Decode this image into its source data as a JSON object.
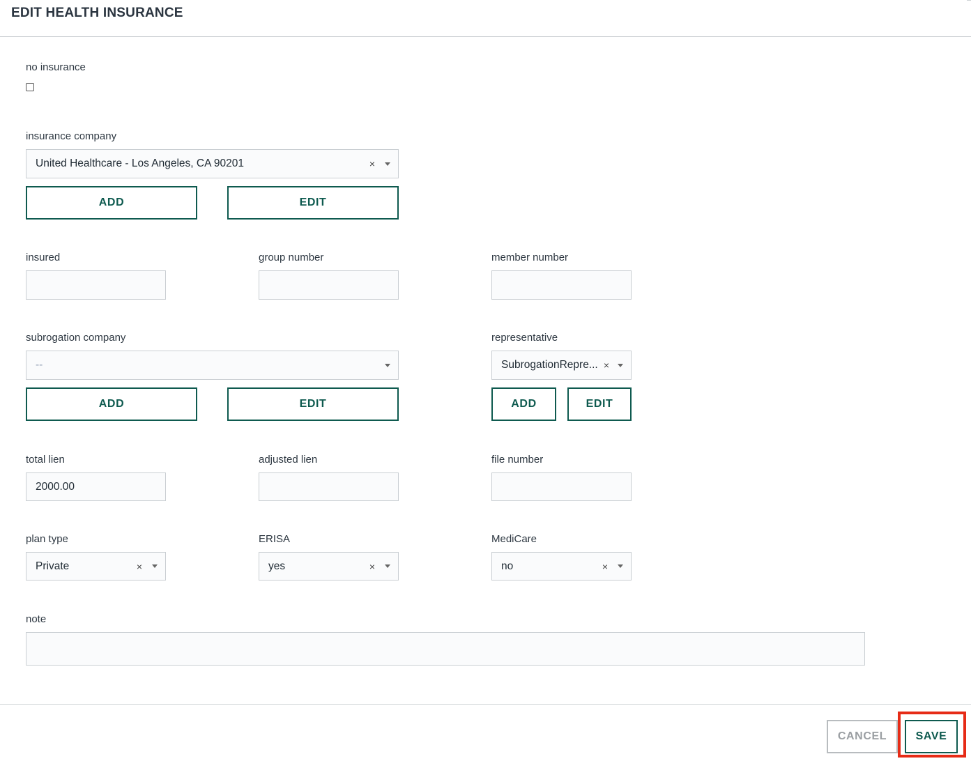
{
  "header": {
    "title": "EDIT HEALTH INSURANCE"
  },
  "no_insurance": {
    "label": "no insurance",
    "checked": false
  },
  "insurance_company": {
    "label": "insurance company",
    "value": "United Healthcare - Los Angeles, CA 90201",
    "clear_icon": "×",
    "add_label": "ADD",
    "edit_label": "EDIT"
  },
  "insured": {
    "label": "insured",
    "value": ""
  },
  "group_number": {
    "label": "group number",
    "value": ""
  },
  "member_number": {
    "label": "member number",
    "value": ""
  },
  "subrogation_company": {
    "label": "subrogation company",
    "placeholder": "--",
    "add_label": "ADD",
    "edit_label": "EDIT"
  },
  "representative": {
    "label": "representative",
    "value": "SubrogationRepre...",
    "clear_icon": "×",
    "add_label": "ADD",
    "edit_label": "EDIT"
  },
  "total_lien": {
    "label": "total lien",
    "value": "2000.00"
  },
  "adjusted_lien": {
    "label": "adjusted lien",
    "value": ""
  },
  "file_number": {
    "label": "file number",
    "value": ""
  },
  "plan_type": {
    "label": "plan type",
    "value": "Private",
    "clear_icon": "×"
  },
  "erisa": {
    "label": "ERISA",
    "value": "yes",
    "clear_icon": "×"
  },
  "medicare": {
    "label": "MediCare",
    "value": "no",
    "clear_icon": "×"
  },
  "note": {
    "label": "note",
    "value": ""
  },
  "footer": {
    "cancel_label": "CANCEL",
    "save_label": "SAVE",
    "highlight_color": "#e62b16"
  },
  "colors": {
    "accent": "#0e5a4f",
    "border": "#c9ced2",
    "field_bg": "#fafbfc"
  }
}
